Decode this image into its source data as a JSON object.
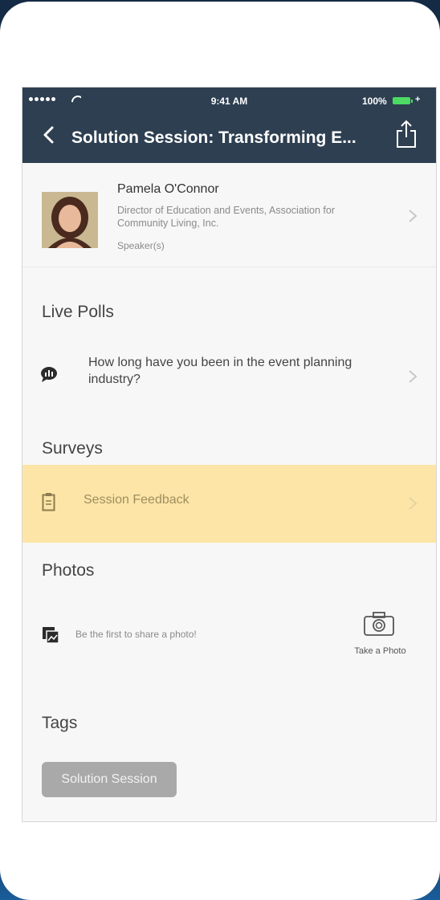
{
  "status_bar": {
    "time": "9:41 AM",
    "battery_percent": "100%",
    "signal_icon": "signal-dots-icon",
    "wifi_icon": "wifi-icon",
    "battery_icon": "battery-icon",
    "battery_color": "#4cd964"
  },
  "nav": {
    "title": "Solution Session: Transforming E...",
    "back_icon": "chevron-left-icon",
    "share_icon": "share-icon",
    "bar_color": "#2e3f51"
  },
  "speaker": {
    "name": "Pamela O'Connor",
    "role": "Director of Education and Events, Association for Community Living, Inc.",
    "tag": "Speaker(s)"
  },
  "live_polls": {
    "title": "Live Polls",
    "question": "How long have you been in the event planning industry?",
    "icon": "poll-chat-icon"
  },
  "surveys": {
    "title": "Surveys",
    "item": "Session Feedback",
    "icon": "clipboard-icon",
    "highlight_color": "#fce5a6"
  },
  "photos": {
    "title": "Photos",
    "empty_text": "Be the first to share a photo!",
    "take_photo": "Take a Photo",
    "icon": "photos-icon",
    "camera_icon": "camera-icon"
  },
  "tags": {
    "title": "Tags",
    "items": [
      "Solution Session"
    ]
  }
}
